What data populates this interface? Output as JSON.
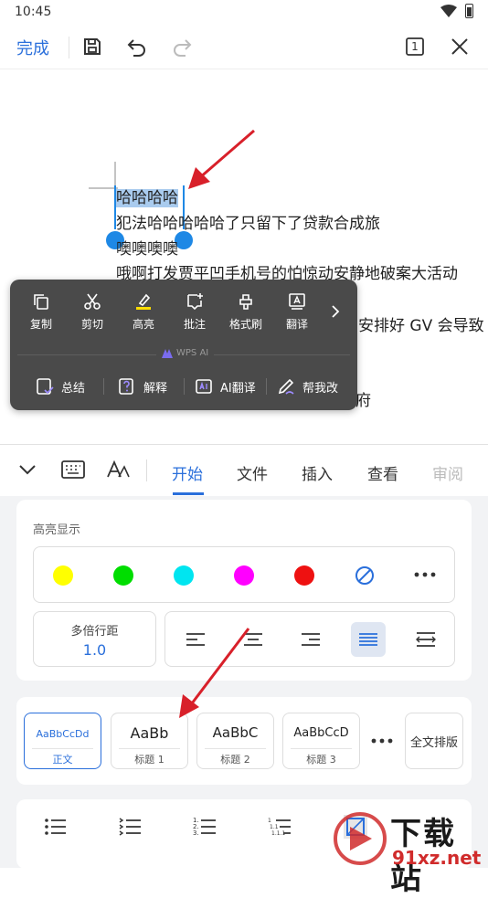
{
  "status": {
    "time": "10:45"
  },
  "toolbar": {
    "done_label": "完成",
    "page_count": "1"
  },
  "document": {
    "selected_text": "哈哈哈哈",
    "lines": [
      "犯法哈哈哈哈哈了只留下了贷款合成旅",
      "噢噢噢噢",
      "哦啊打发贾平凹手机号的怕惊动安静地破案大活动",
      "安排好 GV 会导致",
      "府"
    ]
  },
  "context_menu": {
    "items": [
      "复制",
      "剪切",
      "高亮",
      "批注",
      "格式刷",
      "翻译"
    ],
    "ai_label": "WPS AI",
    "ai_items": [
      "总结",
      "解释",
      "AI翻译",
      "帮我改"
    ]
  },
  "panel": {
    "tabs": [
      "开始",
      "文件",
      "插入",
      "查看",
      "审阅"
    ],
    "active_tab": "开始",
    "highlight_label": "高亮显示",
    "highlight_colors": [
      "#ffff00",
      "#00dd00",
      "#00e5f0",
      "#ff00ff",
      "#ee1111"
    ],
    "line_spacing_label": "多倍行距",
    "line_spacing_value": "1.0",
    "styles": [
      {
        "sample": "AaBbCcDd",
        "name": "正文"
      },
      {
        "sample": "AaBb",
        "name": "标题 1"
      },
      {
        "sample": "AaBbC",
        "name": "标题 2"
      },
      {
        "sample": "AaBbCcD",
        "name": "标题 3"
      }
    ],
    "full_layout_label": "全文排版"
  },
  "watermark": {
    "text": "下载站",
    "url": "91xz.net"
  },
  "colors": {
    "accent": "#2a6fdb",
    "menu_bg": "#4a4a4a",
    "selection": "#a9cbee",
    "arrow": "#d8202a"
  }
}
